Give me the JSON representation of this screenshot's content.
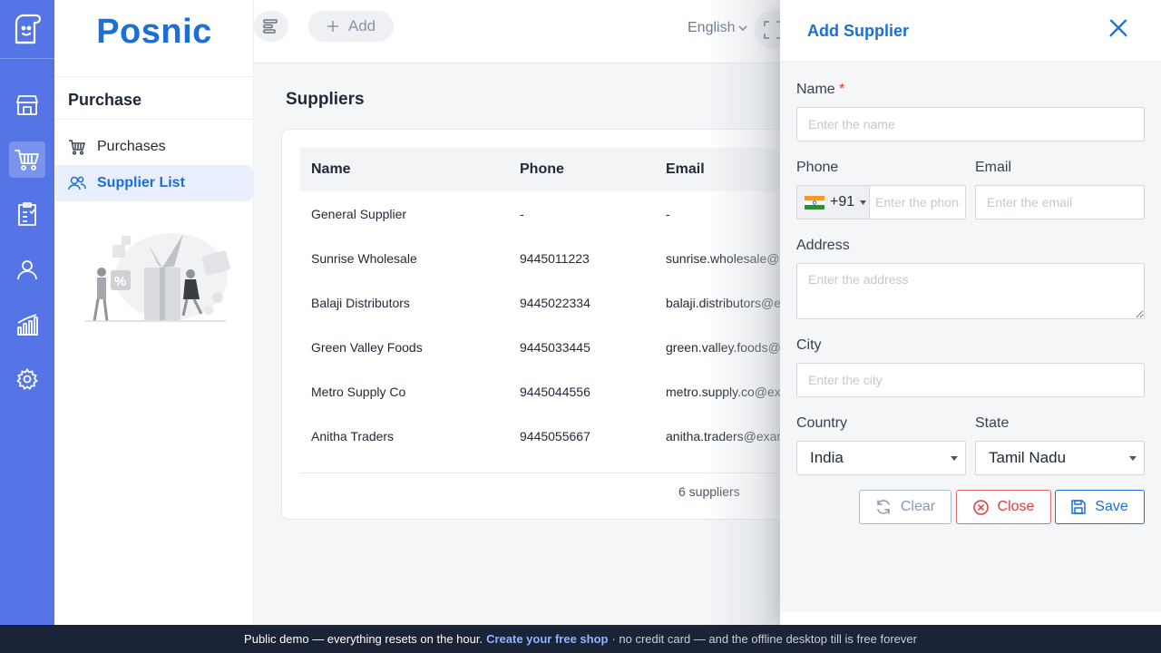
{
  "brand": "Posnic",
  "sidebar": {
    "heading": "Purchase",
    "items": [
      {
        "label": "Purchases",
        "icon": "cart-icon",
        "active": false
      },
      {
        "label": "Supplier List",
        "icon": "users-icon",
        "active": true
      }
    ]
  },
  "topbar": {
    "add_label": "Add",
    "language": "English"
  },
  "page": {
    "title": "Suppliers"
  },
  "table": {
    "columns": [
      "Name",
      "Phone",
      "Email"
    ],
    "rows": [
      {
        "name": "General Supplier",
        "phone": "-",
        "email": "-"
      },
      {
        "name": "Sunrise Wholesale",
        "phone": "9445011223",
        "email": "sunrise.wholesale@e"
      },
      {
        "name": "Balaji Distributors",
        "phone": "9445022334",
        "email": "balaji.distributors@e"
      },
      {
        "name": "Green Valley Foods",
        "phone": "9445033445",
        "email": "green.valley.foods@"
      },
      {
        "name": "Metro Supply Co",
        "phone": "9445044556",
        "email": "metro.supply.co@ex"
      },
      {
        "name": "Anitha Traders",
        "phone": "9445055667",
        "email": "anitha.traders@exam"
      }
    ],
    "footer": "6 suppliers"
  },
  "drawer": {
    "title": "Add Supplier",
    "name_label": "Name",
    "name_required": "*",
    "name_placeholder": "Enter the name",
    "phone_label": "Phone",
    "phone_code": "+91",
    "phone_placeholder": "Enter the phone",
    "email_label": "Email",
    "email_placeholder": "Enter the email",
    "address_label": "Address",
    "address_placeholder": "Enter the address",
    "city_label": "City",
    "city_placeholder": "Enter the city",
    "country_label": "Country",
    "country_value": "India",
    "state_label": "State",
    "state_value": "Tamil Nadu",
    "clear_label": "Clear",
    "close_label": "Close",
    "save_label": "Save"
  },
  "banner": {
    "text": "Public demo — everything resets on the hour.",
    "link": "Create your free shop",
    "suffix": "· no credit card — and the offline desktop till is free forever"
  },
  "colors": {
    "primary": "#1b6fd6",
    "rail": "#5575e7",
    "danger": "#e03c3c",
    "banner": "#1b2436"
  }
}
